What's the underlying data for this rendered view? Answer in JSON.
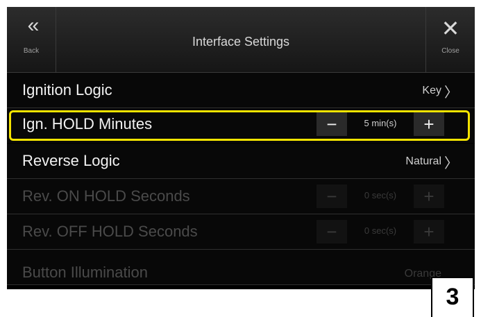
{
  "header": {
    "title": "Interface Settings",
    "back_icon": "«",
    "back_label": "Back",
    "close_icon": "✕",
    "close_label": "Close"
  },
  "rows": [
    {
      "label": "Ignition Logic",
      "value": "Key",
      "chevron": "〉",
      "enabled": true
    },
    {
      "label": "Ign. HOLD Minutes",
      "stepper_value": "5 min(s)",
      "minus": "−",
      "plus": "+",
      "enabled": true,
      "highlighted": true
    },
    {
      "label": "Reverse Logic",
      "value": "Natural",
      "chevron": "〉",
      "enabled": true
    },
    {
      "label": "Rev. ON HOLD Seconds",
      "stepper_value": "0 sec(s)",
      "minus": "−",
      "plus": "+",
      "enabled": false
    },
    {
      "label": "Rev. OFF HOLD Seconds",
      "stepper_value": "0 sec(s)",
      "minus": "−",
      "plus": "+",
      "enabled": false
    },
    {
      "label": "Button Illumination",
      "value": "Orange",
      "enabled": false
    }
  ],
  "highlight_color": "#f5e400",
  "step_badge": "3"
}
